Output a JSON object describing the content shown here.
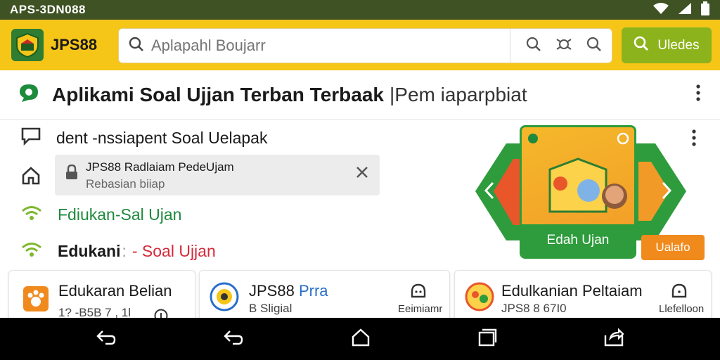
{
  "status_bar": {
    "carrier": "APS-3DN088",
    "wifi_icon": "wifi-icon",
    "signal_icon": "signal-icon",
    "battery_icon": "battery-icon"
  },
  "app_bar": {
    "brand": "JPS88",
    "search_placeholder": "Aplapahl Boujarr",
    "primary_button_label": "Uledes"
  },
  "title_bar": {
    "title": "Aplikami Soal Ujjan Terban Terbaak",
    "subtitle": "|Pem iaparpbiat"
  },
  "side_list": {
    "item1": "dent -nssiapent Soal Uelapak",
    "chip_title": "JPS88 Radlaiam PedeUjam",
    "chip_subtitle": "Rebasian biiap",
    "item2": "Fdiukan-Sal Ujan",
    "item3_prefix": "Edukani",
    "item3_sep": ":",
    "item3_suffix": "- Soal Ujjan"
  },
  "banner": {
    "card_label": "Edah Ujan",
    "button_label": "Ualafo"
  },
  "cards": [
    {
      "title": "Edukaran Belian",
      "subtitle": "1? -B5B 7 , 1l",
      "action": ""
    },
    {
      "title_prefix": "JPS88 ",
      "title_suffix": "Prra",
      "subtitle": "B Sligial",
      "action": "Eeimiamr"
    },
    {
      "title": "Edulkanian Peltaiam",
      "subtitle": "JPS8 8 67I0",
      "action": "Llefelloon"
    }
  ],
  "colors": {
    "status": "#3f5224",
    "appbar": "#f5c518",
    "accent_green": "#8db31c",
    "orange": "#f08a1c",
    "green_text": "#1e8a3c",
    "red_text": "#d42a3a",
    "blue_text": "#2a6fc9"
  }
}
